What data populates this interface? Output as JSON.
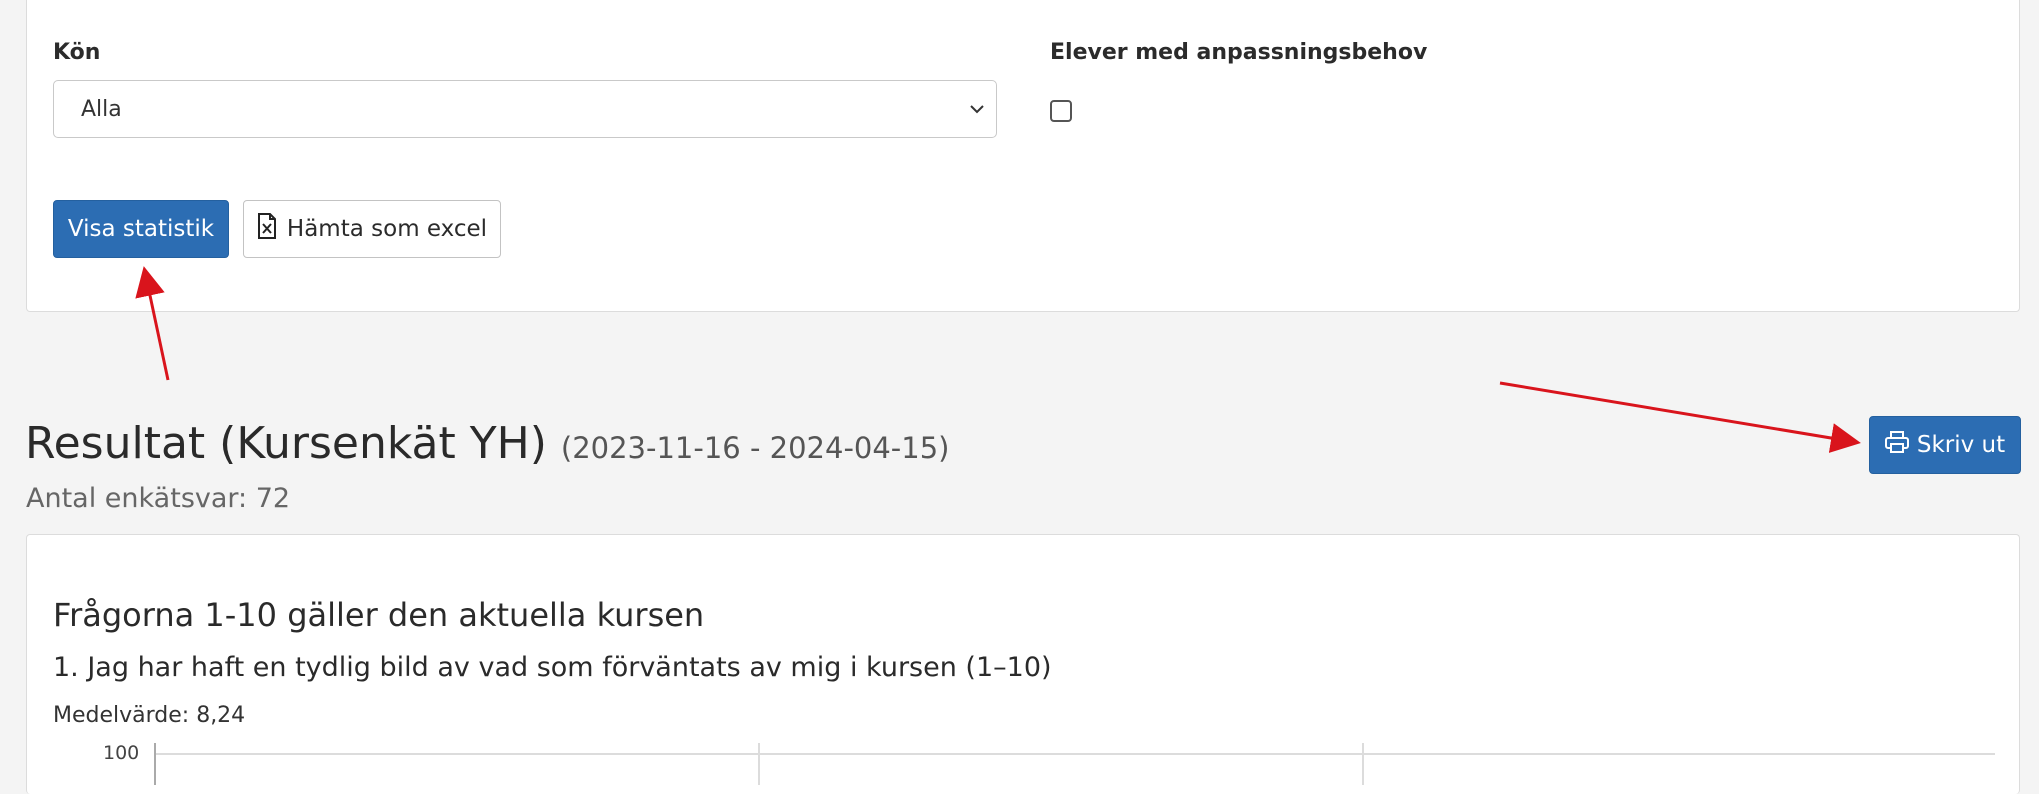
{
  "filters": {
    "gender_label": "Kön",
    "gender_value": "Alla",
    "special_needs_label": "Elever med anpassningsbehov"
  },
  "actions": {
    "show_stats": "Visa statistik",
    "export_excel": "Hämta som excel",
    "print": "Skriv ut"
  },
  "results": {
    "title": "Resultat (Kursenkät YH)",
    "date_range": "(2023-11-16 - 2024-04-15)",
    "response_count": "Antal enkätsvar: 72"
  },
  "survey": {
    "section_title": "Frågorna 1-10 gäller den aktuella kursen",
    "question": "1. Jag har haft en tydlig bild av vad som förväntats av mig i kursen (1–10)",
    "mean": "Medelvärde: 8,24",
    "y_tick_top": "100"
  },
  "colors": {
    "primary": "#2c6db3",
    "annotation_arrow": "#d9141c"
  },
  "icons": [
    "chevron-down-icon",
    "excel-file-icon",
    "printer-icon"
  ]
}
